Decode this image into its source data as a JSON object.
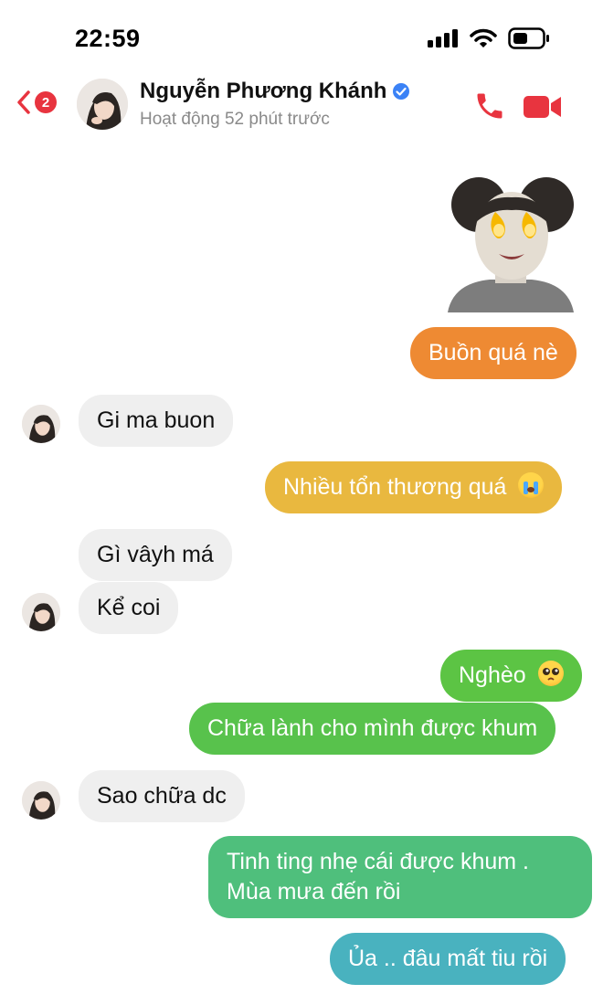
{
  "status_bar": {
    "time": "22:59"
  },
  "header": {
    "unread_count": "2",
    "contact_name": "Nguyễn Phương Khánh",
    "contact_status": "Hoạt động 52 phút trước",
    "verified": true
  },
  "messages": [
    {
      "from": "me",
      "text": "Buồn quá nè",
      "color": "#ee8a33"
    },
    {
      "from": "them",
      "text": "Gi ma buon"
    },
    {
      "from": "me",
      "text": "Nhiều tổn thương quá",
      "color": "#e9b83f",
      "emoji": "loudly-crying-face"
    },
    {
      "from": "them",
      "text": "Gì vâyh má"
    },
    {
      "from": "them",
      "text": "Kể coi"
    },
    {
      "from": "me",
      "text": "Nghèo",
      "color": "#5cc444",
      "emoji": "pleading-face"
    },
    {
      "from": "me",
      "text": "Chữa lành cho mình được khum",
      "color": "#58c24c"
    },
    {
      "from": "them",
      "text": "Sao chữa dc"
    },
    {
      "from": "me",
      "line1": "Tinh ting nhẹ cái được khum .",
      "line2": "Mùa mưa đến rồi",
      "color": "#4fbf7c"
    },
    {
      "from": "me",
      "text": "Ủa .. đâu mất tiu rồi",
      "color": "#49b2bf"
    }
  ],
  "colors": {
    "accent": "#e8343f",
    "incoming_bubble": "#efefef",
    "verified": "#3b82f6"
  }
}
